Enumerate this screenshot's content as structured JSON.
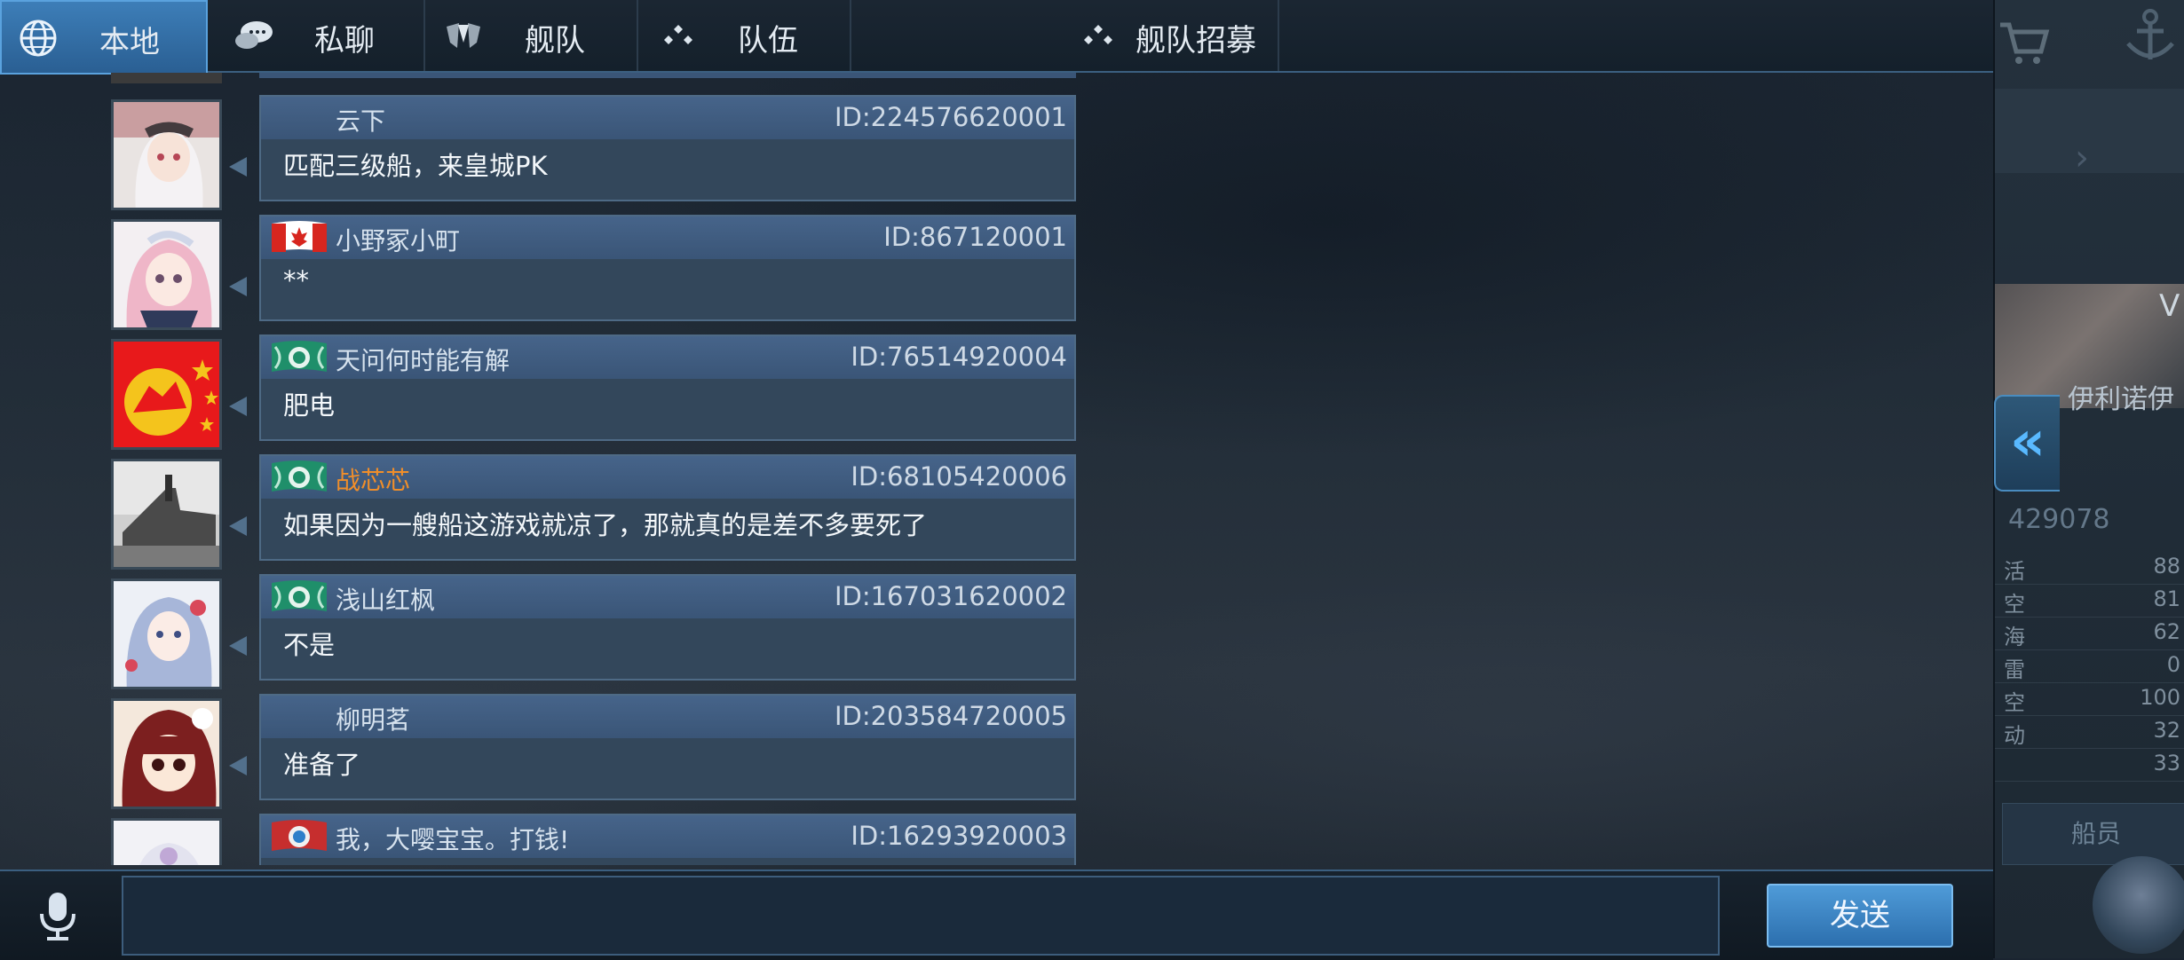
{
  "tabs": [
    {
      "label": "本地",
      "icon": "globe-icon",
      "active": true
    },
    {
      "label": "私聊",
      "icon": "chat-bubbles-icon",
      "active": false
    },
    {
      "label": "舰队",
      "icon": "fleet-emblem-icon",
      "active": false
    },
    {
      "label": "队伍",
      "icon": "team-dots-icon",
      "active": false
    },
    {
      "label": "舰队招募",
      "icon": "team-dots-icon",
      "active": false
    }
  ],
  "messages": [
    {
      "name": "云下",
      "id": "ID:224576620001",
      "text": "匹配三级船，来皇城PK",
      "flag": "none",
      "name_color": "#d6e2ee"
    },
    {
      "name": "小野冢小町",
      "id": "ID:867120001",
      "text": "**",
      "flag": "canada-flag",
      "name_color": "#d6e2ee"
    },
    {
      "name": "天问何时能有解",
      "id": "ID:76514920004",
      "text": "肥电",
      "flag": "green-emblem",
      "name_color": "#d6e2ee"
    },
    {
      "name": "战芯芯",
      "id": "ID:68105420006",
      "text": "如果因为一艘船这游戏就凉了，那就真的是差不多要死了",
      "flag": "green-emblem",
      "name_color": "#f08e2a"
    },
    {
      "name": "浅山红枫",
      "id": "ID:167031620002",
      "text": "不是",
      "flag": "green-emblem",
      "name_color": "#d6e2ee"
    },
    {
      "name": "柳明茗",
      "id": "ID:203584720005",
      "text": "准备了",
      "flag": "none",
      "name_color": "#d6e2ee"
    },
    {
      "name": "我，大嘤宝宝。打钱!",
      "id": "ID:16293920003",
      "text": "",
      "flag": "red-emblem",
      "name_color": "#d6e2ee"
    }
  ],
  "input": {
    "value": "",
    "placeholder": ""
  },
  "send_label": "发送",
  "side": {
    "ship_name": "伊利诺伊",
    "version_letter": "V",
    "id_text": "429078",
    "stats": [
      {
        "label": "活",
        "value": "88"
      },
      {
        "label": "空",
        "value": "81"
      },
      {
        "label": "海",
        "value": "62"
      },
      {
        "label": "雷",
        "value": "0"
      },
      {
        "label": "空",
        "value": "100"
      },
      {
        "label": "动",
        "value": "32"
      },
      {
        "label": "",
        "value": "33"
      }
    ],
    "crew_label": "船员"
  },
  "colors": {
    "accent": "#3d7eb8",
    "orange_name": "#f08e2a",
    "collapse": "#59b9ff"
  }
}
